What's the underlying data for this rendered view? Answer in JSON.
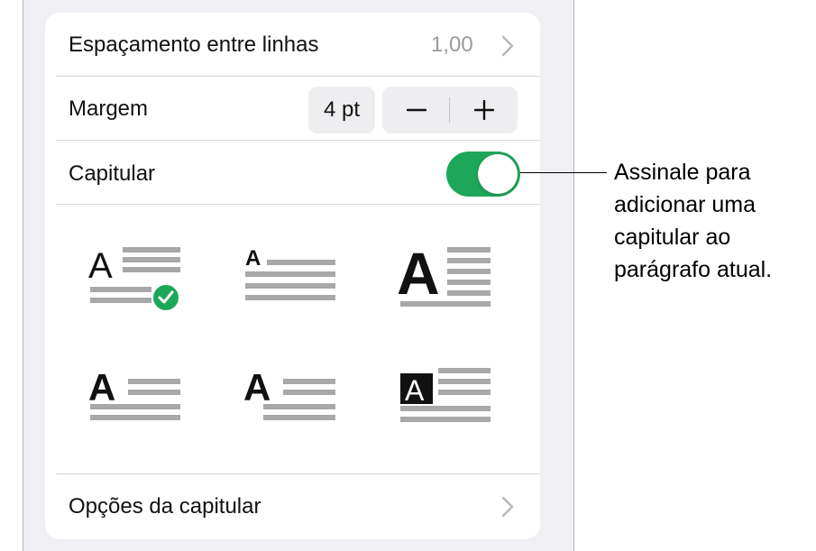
{
  "panel": {
    "line_spacing": {
      "label": "Espaçamento entre linhas",
      "value": "1,00"
    },
    "margin": {
      "label": "Margem",
      "value": "4 pt",
      "decrement_symbol": "−",
      "increment_symbol": "+"
    },
    "drop_cap": {
      "label": "Capitular",
      "enabled": true
    },
    "drop_cap_styles": {
      "selected_index": 0,
      "options": [
        {
          "glyph": "A"
        },
        {
          "glyph": "A"
        },
        {
          "glyph": "A"
        },
        {
          "glyph": "A"
        },
        {
          "glyph": "A"
        },
        {
          "glyph": "A"
        }
      ]
    },
    "drop_cap_options": {
      "label": "Opções da capitular"
    }
  },
  "callout": {
    "lines": [
      "Assinale para",
      "adicionar uma",
      "capitular ao",
      "parágrafo atual."
    ]
  },
  "colors": {
    "accent_green": "#1ea75a",
    "secondary_text": "#9a9a9f",
    "line_gray": "#a8a8ab"
  }
}
